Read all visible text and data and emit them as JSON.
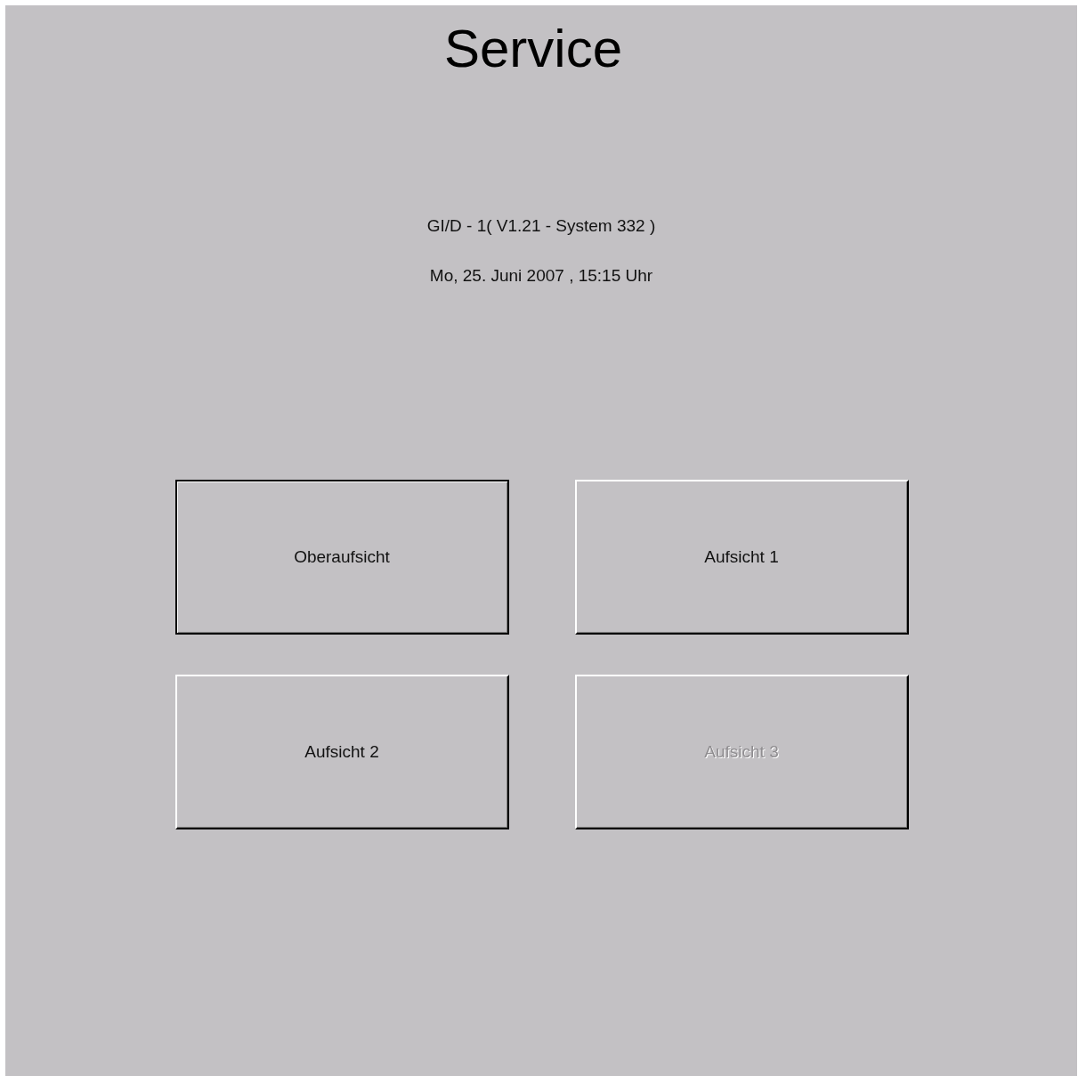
{
  "title": "Service",
  "info_lines": [
    "GI/D - 1( V1.21 - System 332 )",
    "Mo, 25. Juni 2007 , 15:15 Uhr"
  ],
  "buttons": [
    {
      "label": "Oberaufsicht",
      "focused": true,
      "disabled": false
    },
    {
      "label": "Aufsicht 1",
      "focused": false,
      "disabled": false
    },
    {
      "label": "Aufsicht 2",
      "focused": false,
      "disabled": false
    },
    {
      "label": "Aufsicht 3",
      "focused": false,
      "disabled": true
    }
  ]
}
